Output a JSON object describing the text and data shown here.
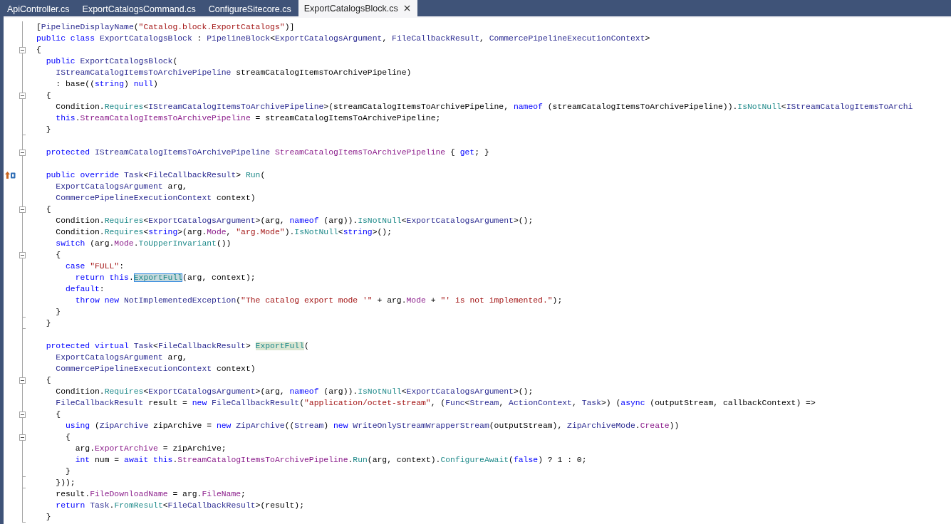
{
  "tabs": [
    {
      "label": "ApiController.cs",
      "selected": false
    },
    {
      "label": "ExportCatalogsCommand.cs",
      "selected": false
    },
    {
      "label": "ConfigureSitecore.cs",
      "selected": false
    },
    {
      "label": "ExportCatalogsBlock.cs",
      "selected": true
    }
  ],
  "editor": {
    "lines": [
      {
        "kind": "code",
        "collapsible": false,
        "block_end": false,
        "override_marker": false,
        "tokens": [
          {
            "kind": "plain",
            "text": "["
          },
          {
            "kind": "type",
            "text": "PipelineDisplayName"
          },
          {
            "kind": "plain",
            "text": "("
          },
          {
            "kind": "str",
            "text": "\"Catalog.block.ExportCatalogs\""
          },
          {
            "kind": "plain",
            "text": ")]"
          }
        ]
      },
      {
        "kind": "code",
        "collapsible": false,
        "block_end": false,
        "override_marker": false,
        "tokens": [
          {
            "kind": "kw",
            "text": "public class "
          },
          {
            "kind": "type",
            "text": "ExportCatalogsBlock"
          },
          {
            "kind": "plain",
            "text": " : "
          },
          {
            "kind": "type",
            "text": "PipelineBlock"
          },
          {
            "kind": "plain",
            "text": "<"
          },
          {
            "kind": "type",
            "text": "ExportCatalogsArgument"
          },
          {
            "kind": "plain",
            "text": ", "
          },
          {
            "kind": "type",
            "text": "FileCallbackResult"
          },
          {
            "kind": "plain",
            "text": ", "
          },
          {
            "kind": "type",
            "text": "CommercePipelineExecutionContext"
          },
          {
            "kind": "plain",
            "text": ">"
          }
        ]
      },
      {
        "kind": "code",
        "collapsible": true,
        "block_end": false,
        "override_marker": false,
        "tokens": [
          {
            "kind": "plain",
            "text": "{"
          }
        ]
      },
      {
        "kind": "code",
        "collapsible": false,
        "block_end": false,
        "override_marker": false,
        "tokens": [
          {
            "kind": "kw",
            "text": "  public "
          },
          {
            "kind": "type",
            "text": "ExportCatalogsBlock"
          },
          {
            "kind": "plain",
            "text": "("
          }
        ]
      },
      {
        "kind": "code",
        "collapsible": false,
        "block_end": false,
        "override_marker": false,
        "tokens": [
          {
            "kind": "type",
            "text": "    IStreamCatalogItemsToArchivePipeline"
          },
          {
            "kind": "plain",
            "text": " streamCatalogItemsToArchivePipeline)"
          }
        ]
      },
      {
        "kind": "code",
        "collapsible": false,
        "block_end": false,
        "override_marker": false,
        "tokens": [
          {
            "kind": "plain",
            "text": "    : base(("
          },
          {
            "kind": "kw",
            "text": "string"
          },
          {
            "kind": "plain",
            "text": ") "
          },
          {
            "kind": "kw",
            "text": "null"
          },
          {
            "kind": "plain",
            "text": ")"
          }
        ]
      },
      {
        "kind": "code",
        "collapsible": true,
        "block_end": false,
        "override_marker": false,
        "tokens": [
          {
            "kind": "plain",
            "text": "  {"
          }
        ]
      },
      {
        "kind": "code",
        "collapsible": false,
        "block_end": false,
        "override_marker": false,
        "tokens": [
          {
            "kind": "plain",
            "text": "    Condition."
          },
          {
            "kind": "method",
            "text": "Requires"
          },
          {
            "kind": "plain",
            "text": "<"
          },
          {
            "kind": "type",
            "text": "IStreamCatalogItemsToArchivePipeline"
          },
          {
            "kind": "plain",
            "text": ">(streamCatalogItemsToArchivePipeline, "
          },
          {
            "kind": "kw",
            "text": "nameof"
          },
          {
            "kind": "plain",
            "text": " (streamCatalogItemsToArchivePipeline))."
          },
          {
            "kind": "method",
            "text": "IsNotNull"
          },
          {
            "kind": "plain",
            "text": "<"
          },
          {
            "kind": "type",
            "text": "IStreamCatalogItemsToArchi"
          }
        ]
      },
      {
        "kind": "code",
        "collapsible": false,
        "block_end": false,
        "override_marker": false,
        "tokens": [
          {
            "kind": "kw",
            "text": "    this"
          },
          {
            "kind": "plain",
            "text": "."
          },
          {
            "kind": "prop",
            "text": "StreamCatalogItemsToArchivePipeline"
          },
          {
            "kind": "plain",
            "text": " = streamCatalogItemsToArchivePipeline;"
          }
        ]
      },
      {
        "kind": "code",
        "collapsible": false,
        "block_end": true,
        "override_marker": false,
        "tokens": [
          {
            "kind": "plain",
            "text": "  }"
          }
        ]
      },
      {
        "kind": "blank",
        "collapsible": false,
        "block_end": false,
        "override_marker": false
      },
      {
        "kind": "code",
        "collapsible": true,
        "block_end": false,
        "override_marker": false,
        "tokens": [
          {
            "kind": "kw",
            "text": "  protected "
          },
          {
            "kind": "type",
            "text": "IStreamCatalogItemsToArchivePipeline "
          },
          {
            "kind": "prop",
            "text": "StreamCatalogItemsToArchivePipeline"
          },
          {
            "kind": "plain",
            "text": " { "
          },
          {
            "kind": "kw",
            "text": "get"
          },
          {
            "kind": "plain",
            "text": "; }"
          }
        ]
      },
      {
        "kind": "blank",
        "collapsible": false,
        "block_end": false,
        "override_marker": false
      },
      {
        "kind": "code",
        "collapsible": false,
        "block_end": false,
        "override_marker": true,
        "tokens": [
          {
            "kind": "kw",
            "text": "  public override "
          },
          {
            "kind": "type",
            "text": "Task"
          },
          {
            "kind": "plain",
            "text": "<"
          },
          {
            "kind": "type",
            "text": "FileCallbackResult"
          },
          {
            "kind": "plain",
            "text": "> "
          },
          {
            "kind": "method",
            "text": "Run"
          },
          {
            "kind": "plain",
            "text": "("
          }
        ]
      },
      {
        "kind": "code",
        "collapsible": false,
        "block_end": false,
        "override_marker": false,
        "tokens": [
          {
            "kind": "type",
            "text": "    ExportCatalogsArgument"
          },
          {
            "kind": "plain",
            "text": " arg,"
          }
        ]
      },
      {
        "kind": "code",
        "collapsible": false,
        "block_end": false,
        "override_marker": false,
        "tokens": [
          {
            "kind": "type",
            "text": "    CommercePipelineExecutionContext"
          },
          {
            "kind": "plain",
            "text": " context)"
          }
        ]
      },
      {
        "kind": "code",
        "collapsible": true,
        "block_end": false,
        "override_marker": false,
        "tokens": [
          {
            "kind": "plain",
            "text": "  {"
          }
        ]
      },
      {
        "kind": "code",
        "collapsible": false,
        "block_end": false,
        "override_marker": false,
        "tokens": [
          {
            "kind": "plain",
            "text": "    Condition."
          },
          {
            "kind": "method",
            "text": "Requires"
          },
          {
            "kind": "plain",
            "text": "<"
          },
          {
            "kind": "type",
            "text": "ExportCatalogsArgument"
          },
          {
            "kind": "plain",
            "text": ">(arg, "
          },
          {
            "kind": "kw",
            "text": "nameof"
          },
          {
            "kind": "plain",
            "text": " (arg))."
          },
          {
            "kind": "method",
            "text": "IsNotNull"
          },
          {
            "kind": "plain",
            "text": "<"
          },
          {
            "kind": "type",
            "text": "ExportCatalogsArgument"
          },
          {
            "kind": "plain",
            "text": ">();"
          }
        ]
      },
      {
        "kind": "code",
        "collapsible": false,
        "block_end": false,
        "override_marker": false,
        "tokens": [
          {
            "kind": "plain",
            "text": "    Condition."
          },
          {
            "kind": "method",
            "text": "Requires"
          },
          {
            "kind": "plain",
            "text": "<"
          },
          {
            "kind": "kw",
            "text": "string"
          },
          {
            "kind": "plain",
            "text": ">(arg."
          },
          {
            "kind": "prop",
            "text": "Mode"
          },
          {
            "kind": "plain",
            "text": ", "
          },
          {
            "kind": "str",
            "text": "\"arg.Mode\""
          },
          {
            "kind": "plain",
            "text": ")."
          },
          {
            "kind": "method",
            "text": "IsNotNull"
          },
          {
            "kind": "plain",
            "text": "<"
          },
          {
            "kind": "kw",
            "text": "string"
          },
          {
            "kind": "plain",
            "text": ">();"
          }
        ]
      },
      {
        "kind": "code",
        "collapsible": false,
        "block_end": false,
        "override_marker": false,
        "tokens": [
          {
            "kind": "kw",
            "text": "    switch"
          },
          {
            "kind": "plain",
            "text": " (arg."
          },
          {
            "kind": "prop",
            "text": "Mode"
          },
          {
            "kind": "plain",
            "text": "."
          },
          {
            "kind": "method",
            "text": "ToUpperInvariant"
          },
          {
            "kind": "plain",
            "text": "())"
          }
        ]
      },
      {
        "kind": "code",
        "collapsible": true,
        "block_end": false,
        "override_marker": false,
        "tokens": [
          {
            "kind": "plain",
            "text": "    {"
          }
        ]
      },
      {
        "kind": "code",
        "collapsible": false,
        "block_end": false,
        "override_marker": false,
        "tokens": [
          {
            "kind": "kw",
            "text": "      case "
          },
          {
            "kind": "str",
            "text": "\"FULL\""
          },
          {
            "kind": "plain",
            "text": ":"
          }
        ]
      },
      {
        "kind": "code",
        "collapsible": false,
        "block_end": false,
        "override_marker": false,
        "tokens": [
          {
            "kind": "kw",
            "text": "        return this"
          },
          {
            "kind": "plain",
            "text": "."
          },
          {
            "kind": "ref",
            "text": "ExportFull"
          },
          {
            "kind": "plain",
            "text": "(arg, context);"
          }
        ]
      },
      {
        "kind": "code",
        "collapsible": false,
        "block_end": false,
        "override_marker": false,
        "tokens": [
          {
            "kind": "kw",
            "text": "      default"
          },
          {
            "kind": "plain",
            "text": ":"
          }
        ]
      },
      {
        "kind": "code",
        "collapsible": false,
        "block_end": false,
        "override_marker": false,
        "tokens": [
          {
            "kind": "kw",
            "text": "        throw new "
          },
          {
            "kind": "type",
            "text": "NotImplementedException"
          },
          {
            "kind": "plain",
            "text": "("
          },
          {
            "kind": "str",
            "text": "\"The catalog export mode '\""
          },
          {
            "kind": "plain",
            "text": " + arg."
          },
          {
            "kind": "prop",
            "text": "Mode"
          },
          {
            "kind": "plain",
            "text": " + "
          },
          {
            "kind": "str",
            "text": "\"' is not implemented.\""
          },
          {
            "kind": "plain",
            "text": ");"
          }
        ]
      },
      {
        "kind": "code",
        "collapsible": false,
        "block_end": true,
        "override_marker": false,
        "tokens": [
          {
            "kind": "plain",
            "text": "    }"
          }
        ]
      },
      {
        "kind": "code",
        "collapsible": false,
        "block_end": true,
        "override_marker": false,
        "tokens": [
          {
            "kind": "plain",
            "text": "  }"
          }
        ]
      },
      {
        "kind": "blank",
        "collapsible": false,
        "block_end": false,
        "override_marker": false
      },
      {
        "kind": "code",
        "collapsible": false,
        "block_end": false,
        "override_marker": false,
        "tokens": [
          {
            "kind": "kw",
            "text": "  protected virtual "
          },
          {
            "kind": "type",
            "text": "Task"
          },
          {
            "kind": "plain",
            "text": "<"
          },
          {
            "kind": "type",
            "text": "FileCallbackResult"
          },
          {
            "kind": "plain",
            "text": "> "
          },
          {
            "kind": "def",
            "text": "ExportFull"
          },
          {
            "kind": "plain",
            "text": "("
          }
        ]
      },
      {
        "kind": "code",
        "collapsible": false,
        "block_end": false,
        "override_marker": false,
        "tokens": [
          {
            "kind": "type",
            "text": "    ExportCatalogsArgument"
          },
          {
            "kind": "plain",
            "text": " arg,"
          }
        ]
      },
      {
        "kind": "code",
        "collapsible": false,
        "block_end": false,
        "override_marker": false,
        "tokens": [
          {
            "kind": "type",
            "text": "    CommercePipelineExecutionContext"
          },
          {
            "kind": "plain",
            "text": " context)"
          }
        ]
      },
      {
        "kind": "code",
        "collapsible": true,
        "block_end": false,
        "override_marker": false,
        "tokens": [
          {
            "kind": "plain",
            "text": "  {"
          }
        ]
      },
      {
        "kind": "code",
        "collapsible": false,
        "block_end": false,
        "override_marker": false,
        "tokens": [
          {
            "kind": "plain",
            "text": "    Condition."
          },
          {
            "kind": "method",
            "text": "Requires"
          },
          {
            "kind": "plain",
            "text": "<"
          },
          {
            "kind": "type",
            "text": "ExportCatalogsArgument"
          },
          {
            "kind": "plain",
            "text": ">(arg, "
          },
          {
            "kind": "kw",
            "text": "nameof"
          },
          {
            "kind": "plain",
            "text": " (arg))."
          },
          {
            "kind": "method",
            "text": "IsNotNull"
          },
          {
            "kind": "plain",
            "text": "<"
          },
          {
            "kind": "type",
            "text": "ExportCatalogsArgument"
          },
          {
            "kind": "plain",
            "text": ">();"
          }
        ]
      },
      {
        "kind": "code",
        "collapsible": false,
        "block_end": false,
        "override_marker": false,
        "tokens": [
          {
            "kind": "type",
            "text": "    FileCallbackResult"
          },
          {
            "kind": "plain",
            "text": " result = "
          },
          {
            "kind": "kw",
            "text": "new "
          },
          {
            "kind": "type",
            "text": "FileCallbackResult"
          },
          {
            "kind": "plain",
            "text": "("
          },
          {
            "kind": "str",
            "text": "\"application/octet-stream\""
          },
          {
            "kind": "plain",
            "text": ", ("
          },
          {
            "kind": "type",
            "text": "Func"
          },
          {
            "kind": "plain",
            "text": "<"
          },
          {
            "kind": "type",
            "text": "Stream"
          },
          {
            "kind": "plain",
            "text": ", "
          },
          {
            "kind": "type",
            "text": "ActionContext"
          },
          {
            "kind": "plain",
            "text": ", "
          },
          {
            "kind": "type",
            "text": "Task"
          },
          {
            "kind": "plain",
            "text": ">) ("
          },
          {
            "kind": "kw",
            "text": "async"
          },
          {
            "kind": "plain",
            "text": " (outputStream, callbackContext) =>"
          }
        ]
      },
      {
        "kind": "code",
        "collapsible": true,
        "block_end": false,
        "override_marker": false,
        "tokens": [
          {
            "kind": "plain",
            "text": "    {"
          }
        ]
      },
      {
        "kind": "code",
        "collapsible": false,
        "block_end": false,
        "override_marker": false,
        "tokens": [
          {
            "kind": "kw",
            "text": "      using"
          },
          {
            "kind": "plain",
            "text": " ("
          },
          {
            "kind": "type",
            "text": "ZipArchive"
          },
          {
            "kind": "plain",
            "text": " zipArchive = "
          },
          {
            "kind": "kw",
            "text": "new "
          },
          {
            "kind": "type",
            "text": "ZipArchive"
          },
          {
            "kind": "plain",
            "text": "(("
          },
          {
            "kind": "type",
            "text": "Stream"
          },
          {
            "kind": "plain",
            "text": ") "
          },
          {
            "kind": "kw",
            "text": "new "
          },
          {
            "kind": "type",
            "text": "WriteOnlyStreamWrapperStream"
          },
          {
            "kind": "plain",
            "text": "(outputStream), "
          },
          {
            "kind": "type",
            "text": "ZipArchiveMode"
          },
          {
            "kind": "plain",
            "text": "."
          },
          {
            "kind": "prop",
            "text": "Create"
          },
          {
            "kind": "plain",
            "text": "))"
          }
        ]
      },
      {
        "kind": "code",
        "collapsible": true,
        "block_end": false,
        "override_marker": false,
        "tokens": [
          {
            "kind": "plain",
            "text": "      {"
          }
        ]
      },
      {
        "kind": "code",
        "collapsible": false,
        "block_end": false,
        "override_marker": false,
        "tokens": [
          {
            "kind": "plain",
            "text": "        arg."
          },
          {
            "kind": "prop",
            "text": "ExportArchive"
          },
          {
            "kind": "plain",
            "text": " = zipArchive;"
          }
        ]
      },
      {
        "kind": "code",
        "collapsible": false,
        "block_end": false,
        "override_marker": false,
        "tokens": [
          {
            "kind": "kw",
            "text": "        int"
          },
          {
            "kind": "plain",
            "text": " num = "
          },
          {
            "kind": "kw",
            "text": "await this"
          },
          {
            "kind": "plain",
            "text": "."
          },
          {
            "kind": "prop",
            "text": "StreamCatalogItemsToArchivePipeline"
          },
          {
            "kind": "plain",
            "text": "."
          },
          {
            "kind": "method",
            "text": "Run"
          },
          {
            "kind": "plain",
            "text": "(arg, context)."
          },
          {
            "kind": "method",
            "text": "ConfigureAwait"
          },
          {
            "kind": "plain",
            "text": "("
          },
          {
            "kind": "kw",
            "text": "false"
          },
          {
            "kind": "plain",
            "text": ") ? 1 : 0;"
          }
        ]
      },
      {
        "kind": "code",
        "collapsible": false,
        "block_end": true,
        "override_marker": false,
        "tokens": [
          {
            "kind": "plain",
            "text": "      }"
          }
        ]
      },
      {
        "kind": "code",
        "collapsible": false,
        "block_end": true,
        "override_marker": false,
        "tokens": [
          {
            "kind": "plain",
            "text": "    }));"
          }
        ]
      },
      {
        "kind": "code",
        "collapsible": false,
        "block_end": false,
        "override_marker": false,
        "tokens": [
          {
            "kind": "plain",
            "text": "    result."
          },
          {
            "kind": "prop",
            "text": "FileDownloadName"
          },
          {
            "kind": "plain",
            "text": " = arg."
          },
          {
            "kind": "prop",
            "text": "FileName"
          },
          {
            "kind": "plain",
            "text": ";"
          }
        ]
      },
      {
        "kind": "code",
        "collapsible": false,
        "block_end": false,
        "override_marker": false,
        "tokens": [
          {
            "kind": "kw",
            "text": "    return "
          },
          {
            "kind": "type",
            "text": "Task"
          },
          {
            "kind": "plain",
            "text": "."
          },
          {
            "kind": "method",
            "text": "FromResult"
          },
          {
            "kind": "plain",
            "text": "<"
          },
          {
            "kind": "type",
            "text": "FileCallbackResult"
          },
          {
            "kind": "plain",
            "text": ">(result);"
          }
        ]
      },
      {
        "kind": "code",
        "collapsible": false,
        "block_end": true,
        "override_marker": false,
        "tokens": [
          {
            "kind": "plain",
            "text": "  }"
          }
        ]
      }
    ]
  }
}
